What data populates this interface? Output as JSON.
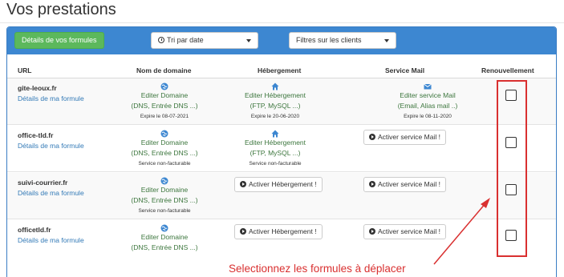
{
  "page": {
    "title": "Vos prestations"
  },
  "toolbar": {
    "details_button": "Détails de vos formules",
    "sort_select": "Tri par date",
    "filter_select": "Filtres sur les clients"
  },
  "table": {
    "headers": {
      "url": "URL",
      "domain": "Nom de domaine",
      "hosting": "Hébergement",
      "mail": "Service Mail",
      "renewal": "Renouvellement"
    },
    "rows": [
      {
        "name": "gite-leoux.fr",
        "link": "Détails de ma formule",
        "domain": {
          "line1": "Editer Domaine",
          "line2": "(DNS, Entrée DNS ...)",
          "note": "Expire le 08-07-2021"
        },
        "hosting": {
          "line1": "Editer Hébergement",
          "line2": "(FTP, MySQL ...)",
          "note": "Expire le 20-06-2020"
        },
        "mail": {
          "line1": "Editer service Mail",
          "line2": "(Email, Alias mail ..)",
          "note": "Expire le 08-11-2020"
        }
      },
      {
        "name": "office-tld.fr",
        "link": "Détails de ma formule",
        "domain": {
          "line1": "Editer Domaine",
          "line2": "(DNS, Entrée DNS ...)",
          "note": "Service non-facturable"
        },
        "hosting": {
          "line1": "Editer Hébergement",
          "line2": "(FTP, MySQL ...)",
          "note": "Service non-facturable"
        },
        "mail_button": "Activer service Mail !"
      },
      {
        "name": "suivi-courrier.fr",
        "link": "Détails de ma formule",
        "domain": {
          "line1": "Editer Domaine",
          "line2": "(DNS, Entrée DNS ...)",
          "note": "Service non-facturable"
        },
        "hosting_button": "Activer Hébergement !",
        "mail_button": "Activer service Mail !"
      },
      {
        "name": "officetld.fr",
        "link": "Détails de ma formule",
        "domain": {
          "line1": "Editer Domaine",
          "line2": "(DNS, Entrée DNS ...)"
        },
        "hosting_button": "Activer Hébergement !",
        "mail_button": "Activer service Mail !"
      }
    ]
  },
  "annotation": {
    "text": "Selectionnez les formules à déplacer"
  },
  "colors": {
    "panel_header": "#3d87d1",
    "green_button": "#5cb85c",
    "link_blue": "#337ab7",
    "service_green": "#3c763d",
    "annotation_red": "#d93030"
  },
  "icons": {
    "domain": "globe-icon",
    "hosting": "home-icon",
    "mail": "envelope-icon",
    "sort": "clock-icon",
    "activate": "circle-arrow-right-icon"
  }
}
